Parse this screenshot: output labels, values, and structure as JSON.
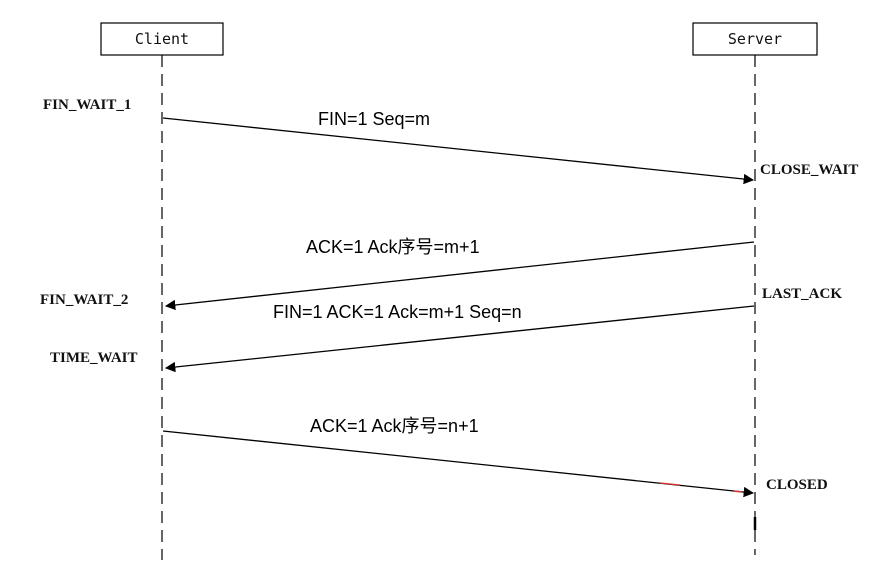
{
  "participants": {
    "client": "Client",
    "server": "Server"
  },
  "states": {
    "fin_wait_1": "FIN_WAIT_1",
    "close_wait": "CLOSE_WAIT",
    "fin_wait_2": "FIN_WAIT_2",
    "last_ack": "LAST_ACK",
    "time_wait": "TIME_WAIT",
    "closed": "CLOSED"
  },
  "messages": {
    "m1": "FIN=1  Seq=m",
    "m2": "ACK=1 Ack序号=m+1",
    "m3": "FIN=1 ACK=1 Ack=m+1 Seq=n",
    "m4": "ACK=1 Ack序号=n+1"
  },
  "colors": {
    "line": "#000000",
    "accent_red": "#d9332b"
  }
}
